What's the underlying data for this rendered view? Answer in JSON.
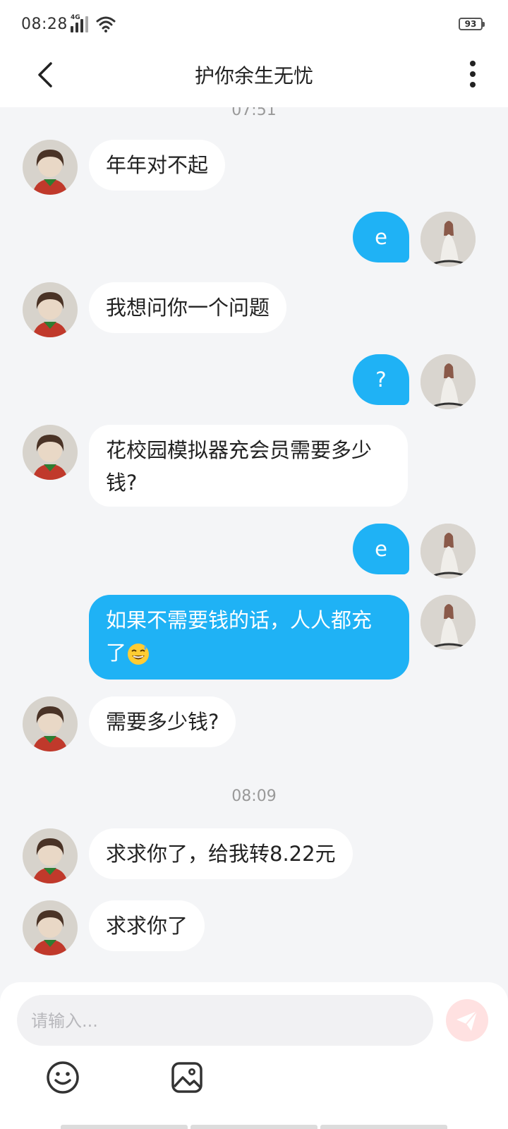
{
  "status_bar": {
    "time": "08:28",
    "network": "4G",
    "battery": "93"
  },
  "header": {
    "title": "护你余生无忧"
  },
  "chat": {
    "timestamps": [
      "07:51",
      "08:09"
    ],
    "messages": [
      {
        "side": "in",
        "text": "年年对不起"
      },
      {
        "side": "out",
        "text": "e"
      },
      {
        "side": "in",
        "text": "我想问你一个问题"
      },
      {
        "side": "out",
        "text": "?"
      },
      {
        "side": "in",
        "line1": "花校园模拟器充会员需要多少",
        "line2": "钱?"
      },
      {
        "side": "out",
        "text": "e"
      },
      {
        "side": "out",
        "line1": "如果不需要钱的话，人人都充",
        "line2": "了",
        "emoji": "sweat-smile-emoji"
      },
      {
        "side": "in",
        "text": "需要多少钱?"
      },
      {
        "side": "in",
        "text": "求求你了，给我转8.22元"
      },
      {
        "side": "in",
        "text": "求求你了"
      }
    ]
  },
  "input": {
    "placeholder": "请输入..."
  },
  "icons": {
    "back": "back-arrow-icon",
    "more": "more-vertical-icon",
    "send": "send-icon",
    "emoji": "emoji-icon",
    "image": "image-icon"
  },
  "colors": {
    "outgoing_bubble": "#1fb2f5",
    "incoming_bubble": "#ffffff",
    "background": "#f4f5f7",
    "send_button": "#ffe1e1"
  }
}
